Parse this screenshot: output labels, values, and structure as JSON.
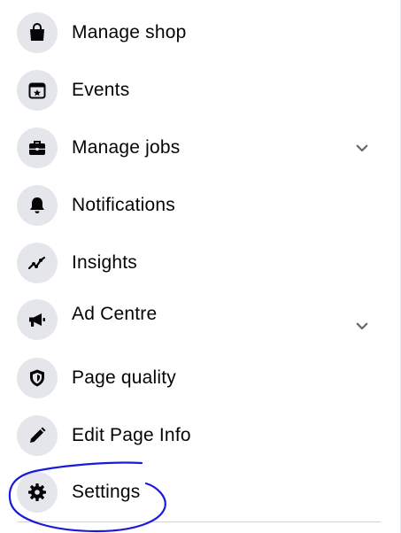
{
  "menu": {
    "items": [
      {
        "label": "Manage shop",
        "icon": "shop-bag-icon"
      },
      {
        "label": "Events",
        "icon": "calendar-star-icon"
      },
      {
        "label": "Manage jobs",
        "icon": "briefcase-icon",
        "expandable": true
      },
      {
        "label": "Notifications",
        "icon": "bell-icon"
      },
      {
        "label": "Insights",
        "icon": "insights-graph-icon"
      },
      {
        "label": "Ad Centre",
        "icon": "megaphone-icon",
        "expandable": true
      },
      {
        "label": "Page quality",
        "icon": "shield-icon"
      },
      {
        "label": "Edit Page Info",
        "icon": "pencil-icon"
      },
      {
        "label": "Settings",
        "icon": "gear-icon"
      }
    ]
  },
  "colors": {
    "icon_background": "#e4e6eb",
    "icon_foreground": "#050505",
    "text": "#050505",
    "chevron": "#65676b",
    "annotation": "#1a1adb"
  }
}
